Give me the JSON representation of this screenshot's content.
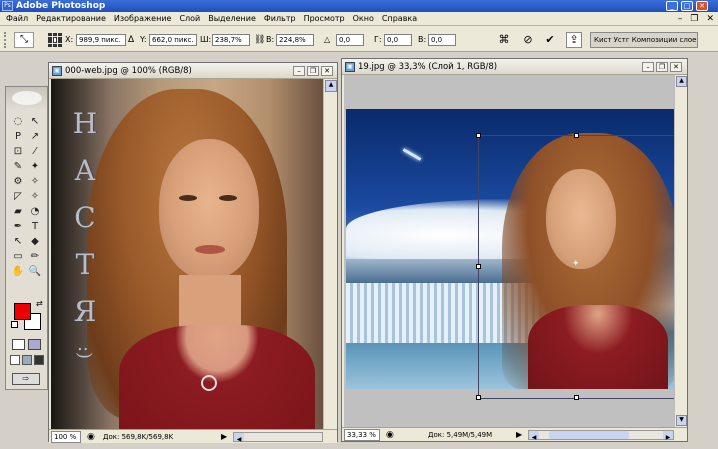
{
  "window": {
    "title": "Adobe Photoshop",
    "icon": "Ps",
    "min": "_",
    "max": "□",
    "close": "✕"
  },
  "menu": [
    "Файл",
    "Редактирование",
    "Изображение",
    "Слой",
    "Выделение",
    "Фильтр",
    "Просмотр",
    "Окно",
    "Справка"
  ],
  "doc_controls": {
    "min": "–",
    "restore": "❐",
    "close": "✕"
  },
  "options": {
    "x_label": "X:",
    "x_value": "989,9 пикс.",
    "y_label": "Y:",
    "y_value": "662,0 пикс.",
    "w_label": "Ш:",
    "w_value": "238,7%",
    "h_label": "В:",
    "h_value": "224,8%",
    "angle_label": "△",
    "angle_value": "0,0",
    "hskew_label": "Г:",
    "hskew_value": "0,0",
    "vskew_label": "В:",
    "vskew_value": "0,0",
    "cancel_icon": "⊘",
    "commit_icon": "✔",
    "palette_wells": "Кист Устг Композиции слоев"
  },
  "toolbox": {
    "tools": [
      "◌",
      "↖",
      "P",
      "↗",
      "⊡",
      "⁄",
      "✎",
      "✦",
      "⚙",
      "✧",
      "◸",
      "✧",
      "▰",
      "◔",
      "✒",
      "T",
      "↖",
      "◆",
      "▭",
      "✏",
      "✋",
      "🔍"
    ],
    "foreground_color": "#ee0000",
    "background_color": "#ffffff"
  },
  "doc1": {
    "title": "000-web.jpg @ 100% (RGB/8)",
    "text_letters": [
      "Н",
      "А",
      "С",
      "Т",
      "Я"
    ],
    "smiley": ":)",
    "zoom": "100 %",
    "doc_info": "Док: 569,8K/569,8K"
  },
  "doc2": {
    "title": "19.jpg @ 33,3% (Слой 1, RGB/8)",
    "zoom": "33,33 %",
    "doc_info": "Док: 5,49M/5,49M"
  }
}
